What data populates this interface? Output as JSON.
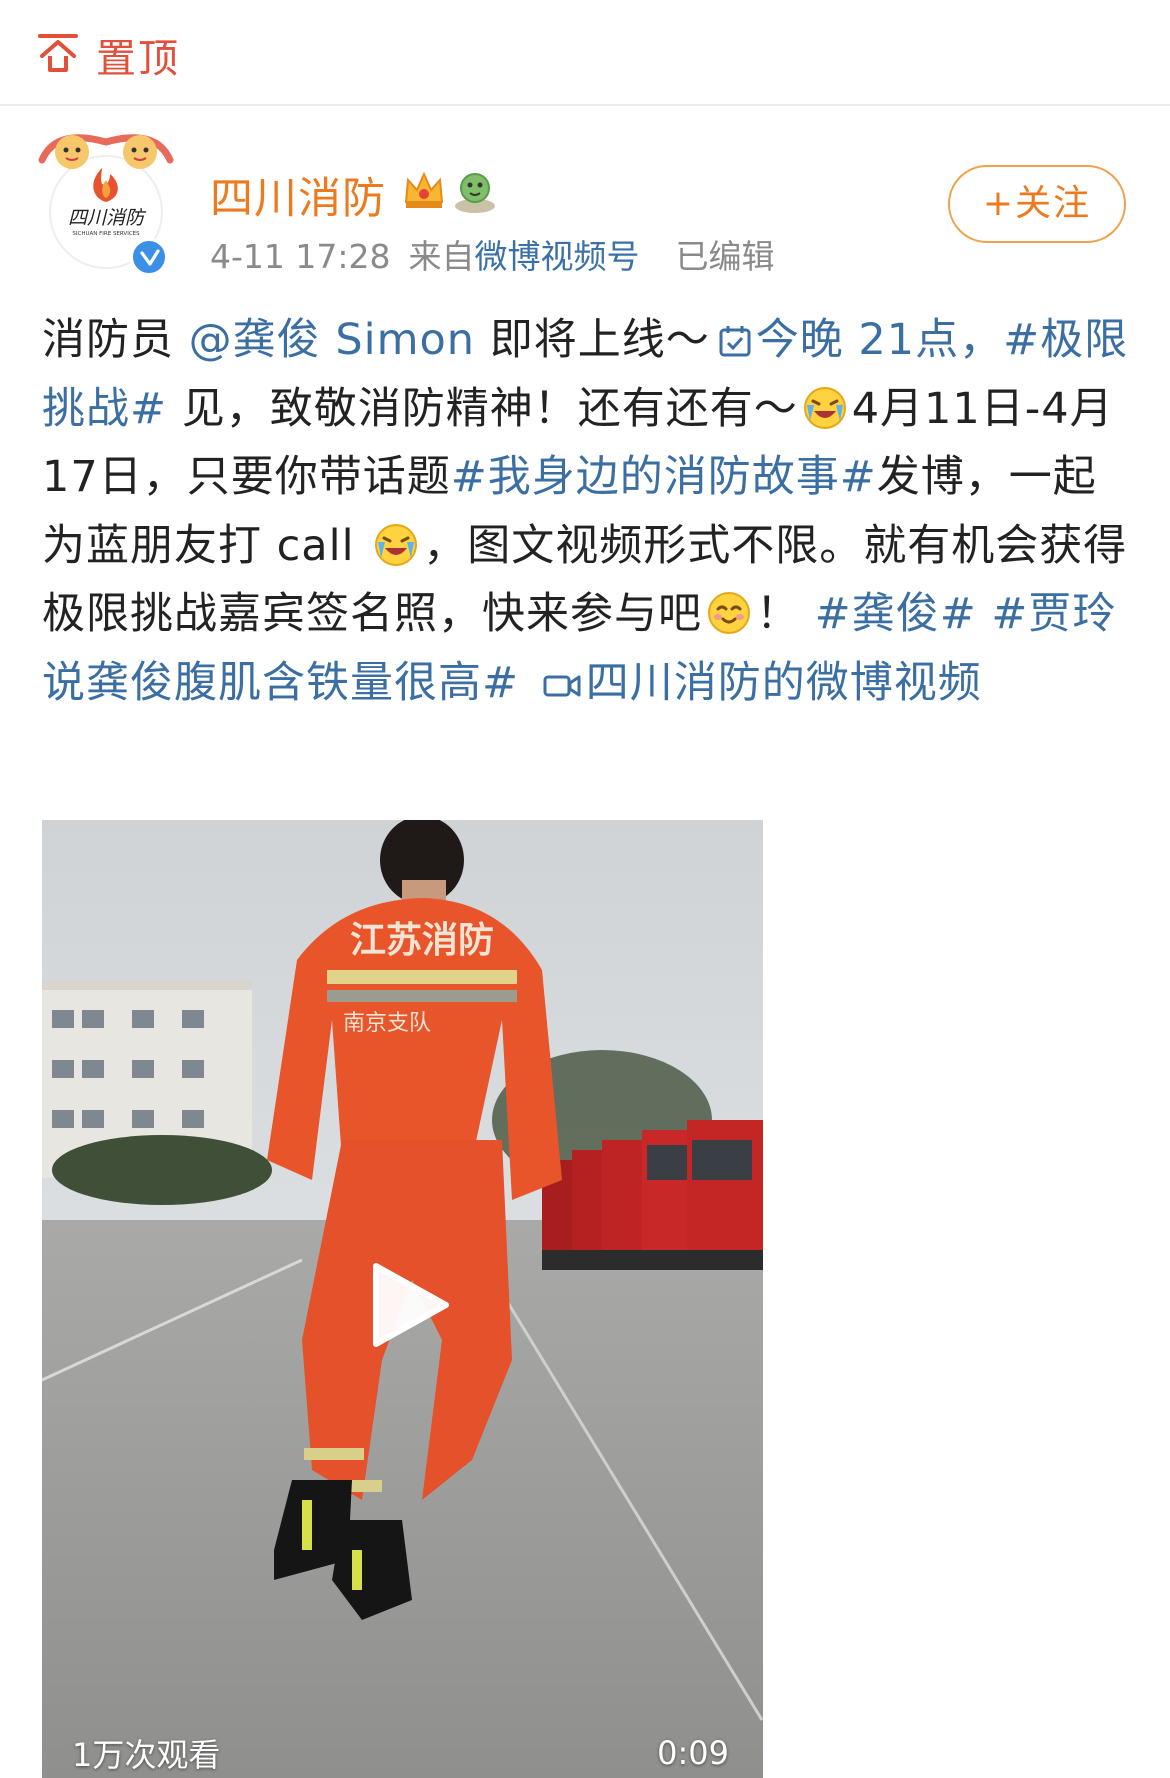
{
  "pinned": {
    "label": "置顶",
    "icon": "pin-top-icon"
  },
  "author": {
    "name": "四川消防",
    "avatar_logo_text": "四川消防",
    "avatar_logo_subtext": "SICHUAN FIRE SERVICES",
    "verified": true
  },
  "meta": {
    "time": "4-11 17:28",
    "via": "来自",
    "source": "微博视频号",
    "edited": "已编辑"
  },
  "follow_button": {
    "plus": "+",
    "label": "关注"
  },
  "post": {
    "t1": "消防员 ",
    "mention": "@龚俊 Simon",
    "t2": " 即将上线～",
    "checkin_text": "今晚 21点，",
    "topic1": "#极限挑战#",
    "t3": " 见，致敬消防精神！还有还有～",
    "t4": "4月11日-4月17日，只要你带话题",
    "topic2": "#我身边的消防故事#",
    "t5": "发博，一起为蓝朋友打 call ",
    "t6": "，图文视频形式不限。就有机会获得极限挑战嘉宾签名照，快来参与吧",
    "t7": "！ ",
    "topic3": "#龚俊#",
    "topic4": "#贾玲说龚俊腹肌含铁量很高#",
    "video_link": "四川消防的微博视频"
  },
  "video": {
    "views": "1万次观看",
    "duration": "0:09",
    "jacket_text": "江苏消防",
    "jacket_subtext": "南京支队"
  }
}
